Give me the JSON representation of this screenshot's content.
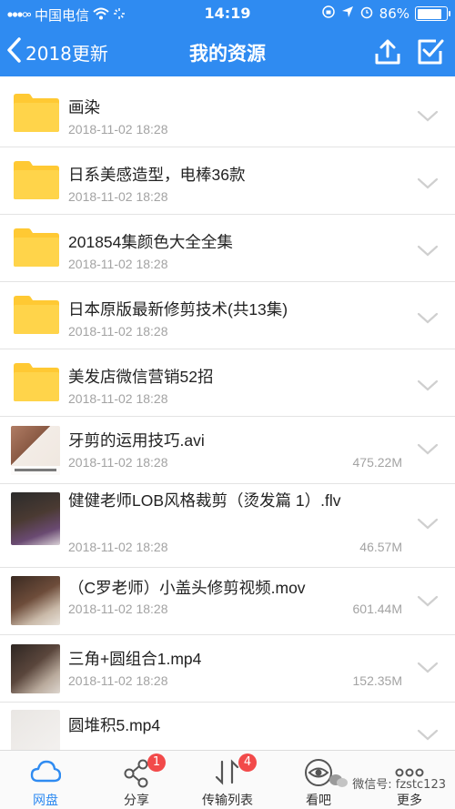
{
  "status_bar": {
    "carrier": "中国电信",
    "time": "14:19",
    "battery_text": "86%",
    "battery_level": 0.86
  },
  "nav": {
    "back_label": "2018更新",
    "title": "我的资源",
    "upload_icon": "upload-icon",
    "select_icon": "checkbox-icon"
  },
  "items": [
    {
      "type": "folder",
      "name": "画染",
      "date": "2018-11-02 18:28",
      "size": ""
    },
    {
      "type": "folder",
      "name": "日系美感造型，电棒36款",
      "date": "2018-11-02 18:28",
      "size": ""
    },
    {
      "type": "folder",
      "name": "201854集颜色大全全集",
      "date": "2018-11-02 18:28",
      "size": ""
    },
    {
      "type": "folder",
      "name": "日本原版最新修剪技术(共13集)",
      "date": "2018-11-02 18:28",
      "size": ""
    },
    {
      "type": "folder",
      "name": "美发店微信营销52招",
      "date": "2018-11-02 18:28",
      "size": ""
    },
    {
      "type": "video",
      "name": "牙剪的运用技巧.avi",
      "date": "2018-11-02 18:28",
      "size": "475.22M"
    },
    {
      "type": "video",
      "name": "健健老师LOB风格裁剪（烫发篇 1）.flv",
      "date": "2018-11-02 18:28",
      "size": "46.57M"
    },
    {
      "type": "video",
      "name": "（C罗老师）小盖头修剪视频.mov",
      "date": "2018-11-02 18:28",
      "size": "601.44M"
    },
    {
      "type": "video",
      "name": "三角+圆组合1.mp4",
      "date": "2018-11-02 18:28",
      "size": "152.35M"
    },
    {
      "type": "video",
      "name": "圆堆积5.mp4",
      "date": "",
      "size": ""
    }
  ],
  "tabs": [
    {
      "label": "网盘",
      "icon": "cloud-icon",
      "badge": ""
    },
    {
      "label": "分享",
      "icon": "share-icon",
      "badge": "1"
    },
    {
      "label": "传输列表",
      "icon": "transfer-icon",
      "badge": "4"
    },
    {
      "label": "看吧",
      "icon": "eye-icon",
      "badge": ""
    },
    {
      "label": "更多",
      "icon": "more-icon",
      "badge": ""
    }
  ],
  "watermark": "微信号: fzstc123",
  "colors": {
    "accent": "#2f8bf1",
    "folder": "#ffc933",
    "badge": "#f24a4a"
  }
}
